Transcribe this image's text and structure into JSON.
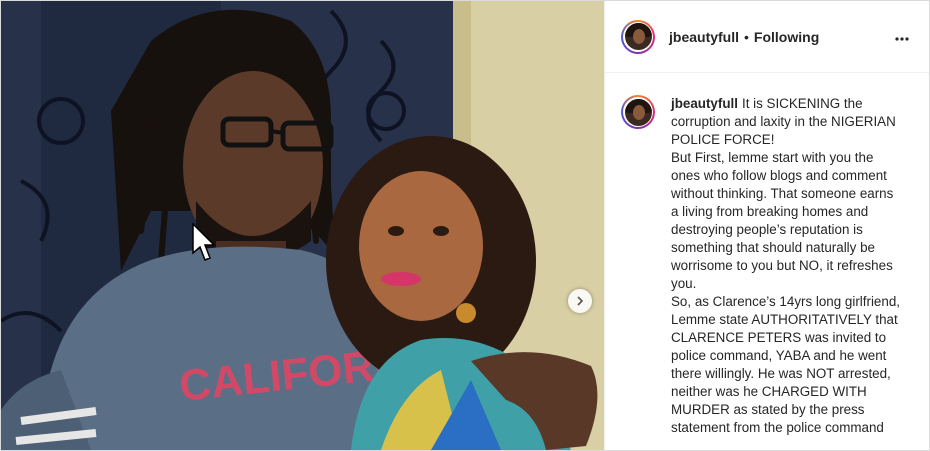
{
  "post": {
    "author": "jbeautyfull",
    "follow_status": "Following",
    "separator": "•",
    "more_icon": "more-options-icon",
    "next_icon": "chevron-right-icon"
  },
  "caption": {
    "username": "jbeautyfull",
    "paragraphs": [
      "It is SICKENING the corruption and laxity in the NIGERIAN POLICE FORCE!",
      "But First, lemme start with you the ones who follow blogs and comment without thinking. That someone earns a living from breaking homes and destroying people’s reputation is something that should naturally be worrisome to you but NO, it refreshes you.",
      "So, as Clarence’s 14yrs long girlfriend, Lemme state AUTHORITATIVELY that CLARENCE PETERS was invited to police command, YABA and he went there willingly. He was NOT arrested, neither was he CHARGED WITH MURDER as stated by the press statement from the police command"
    ]
  },
  "photo": {
    "shirt_text": "CALIFORNIA"
  },
  "colors": {
    "text": "#262626",
    "border": "#dbdbdb"
  }
}
